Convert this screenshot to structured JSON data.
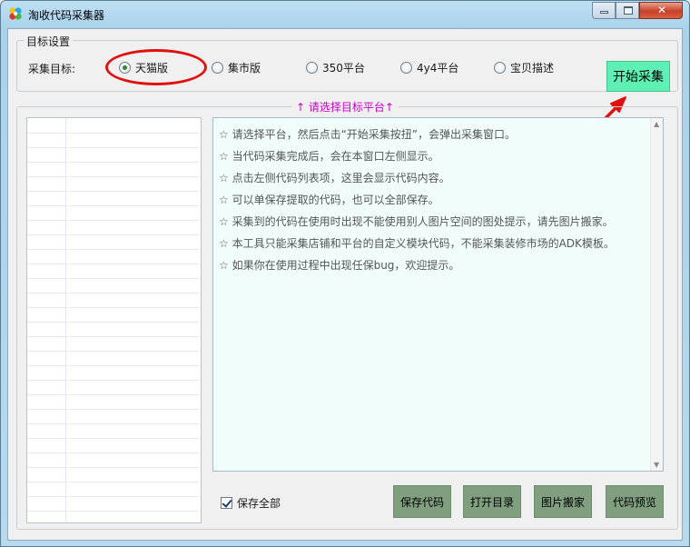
{
  "window": {
    "title": "淘收代码采集器",
    "minimize_glyph": "▭",
    "maximize_glyph": "□",
    "close_glyph": "✕"
  },
  "target_group": {
    "legend": "目标设置",
    "label": "采集目标:",
    "options": [
      {
        "label": "天猫版",
        "selected": true
      },
      {
        "label": "集市版",
        "selected": false
      },
      {
        "label": "350平台",
        "selected": false
      },
      {
        "label": "4y4平台",
        "selected": false
      },
      {
        "label": "宝贝描述",
        "selected": false
      }
    ],
    "start_button": "开始采集"
  },
  "main_panel": {
    "legend": "↑ 请选择目标平台↑",
    "notes": [
      "☆ 请选择平台，然后点击“开始采集按扭”，会弹出采集窗口。",
      "☆ 当代码采集完成后，会在本窗口左侧显示。",
      "☆ 点击左侧代码列表项，这里会显示代码内容。",
      "☆ 可以单保存提取的代码，也可以全部保存。",
      "☆ 采集到的代码在使用时出现不能使用别人图片空间的图处提示，请先图片搬家。",
      "☆ 本工具只能采集店铺和平台的自定义模块代码，不能采集装修市场的ADK模板。",
      "☆ 如果你在使用过程中出现任保bug，欢迎提示。"
    ],
    "save_all_label": "保存全部",
    "save_all_checked": true,
    "buttons": {
      "save_code": "保存代码",
      "open_dir": "打开目录",
      "move_images": "图片搬家",
      "preview": "代码预览"
    }
  },
  "colors": {
    "annotation_red": "#e01010",
    "start_button": "#5ef0b4",
    "action_button": "#7f9f7f",
    "legend_magenta": "#c800c8"
  }
}
